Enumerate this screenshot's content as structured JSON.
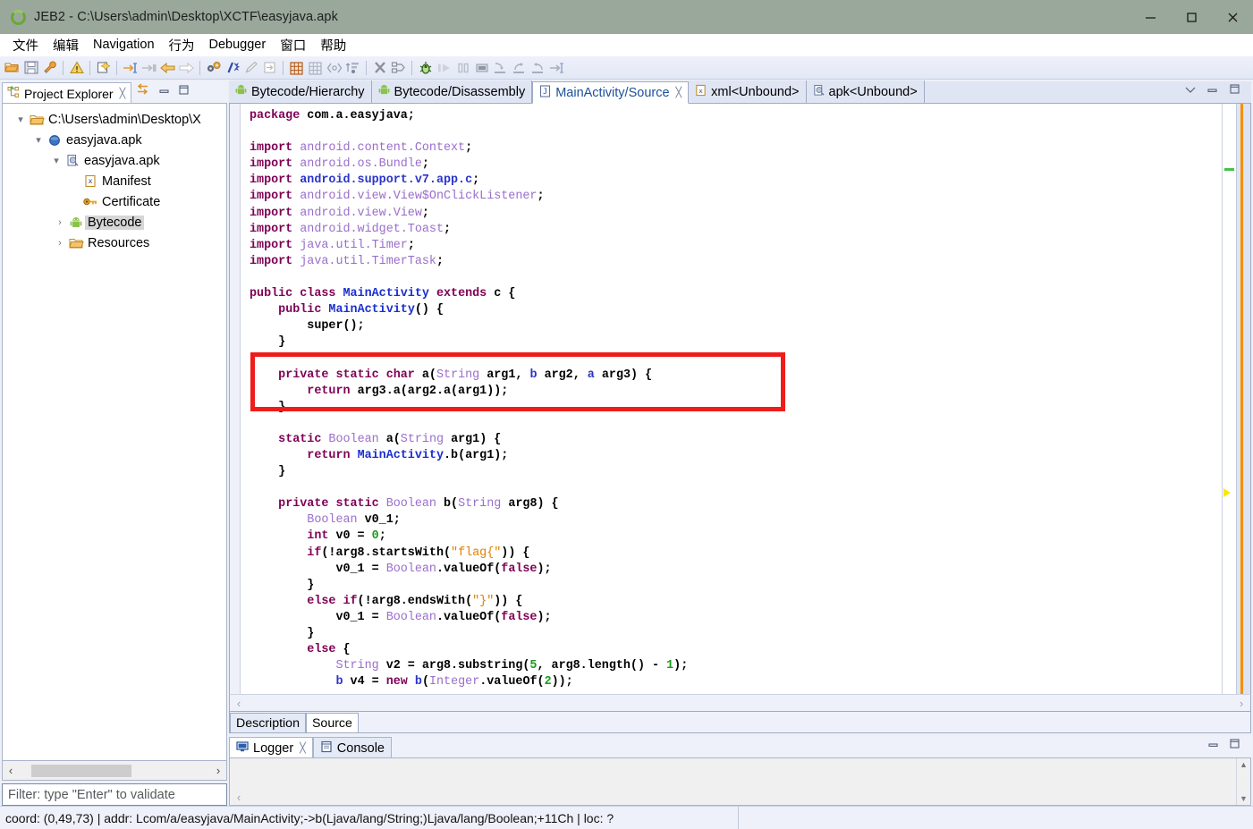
{
  "window": {
    "title": "JEB2 - C:\\Users\\admin\\Desktop\\XCTF\\easyjava.apk",
    "minimize": "—",
    "maximize": "□",
    "close": "✕"
  },
  "menubar": {
    "items": [
      {
        "label": "文件"
      },
      {
        "label": "编辑"
      },
      {
        "label": "Navigation"
      },
      {
        "label": "行为"
      },
      {
        "label": "Debugger"
      },
      {
        "label": "窗口"
      },
      {
        "label": "帮助"
      }
    ]
  },
  "toolbar": {
    "icons": [
      "open-folder-icon",
      "save-icon",
      "wrench-icon",
      "sep",
      "warning-icon",
      "sep",
      "new-document-icon",
      "sep",
      "goto-address-icon",
      "goto-reference-icon",
      "navigate-back-icon",
      "navigate-forward-icon",
      "sep",
      "gears-icon",
      "comment-icon",
      "edit-pencil-icon",
      "export-icon",
      "sep",
      "grid-table-icon",
      "grid-outline-icon",
      "code-brackets-icon",
      "sort-icon",
      "sep",
      "delete-x-icon",
      "refactor-icon",
      "sep",
      "debug-bug-icon",
      "step-over-icon",
      "pause-icon",
      "stop-icon",
      "step-into-icon",
      "step-return-icon",
      "step-out-icon",
      "run-to-line-icon"
    ]
  },
  "project_explorer": {
    "tab_label": "Project Explorer",
    "tab_icon": "project-explorer-icon",
    "close_icon": "close-icon",
    "tools": [
      "link-with-editor-icon",
      "minimize-icon",
      "maximize-icon"
    ],
    "tree": [
      {
        "label": "C:\\Users\\admin\\Desktop\\X",
        "icon": "folder-open-icon",
        "twisty": "▾",
        "indent": 0,
        "selected": false
      },
      {
        "label": "easyjava.apk",
        "icon": "blue-circle-icon",
        "twisty": "▾",
        "indent": 1,
        "selected": false
      },
      {
        "label": "easyjava.apk",
        "icon": "apk-icon",
        "twisty": "▾",
        "indent": 2,
        "selected": false
      },
      {
        "label": "Manifest",
        "icon": "xml-icon",
        "twisty": "",
        "indent": 3,
        "selected": false
      },
      {
        "label": "Certificate",
        "icon": "key-icon",
        "twisty": "",
        "indent": 3,
        "selected": false
      },
      {
        "label": "Bytecode",
        "icon": "android-icon",
        "twisty": "›",
        "indent": 3,
        "selected": true
      },
      {
        "label": "Resources",
        "icon": "folder-icon",
        "twisty": "›",
        "indent": 3,
        "selected": false
      }
    ],
    "hscroll": {
      "left_arrow": "‹",
      "right_arrow": "›"
    },
    "filter_placeholder": "Filter: type \"Enter\" to validate",
    "filter_value": ""
  },
  "editor": {
    "tabs": [
      {
        "label": "Bytecode/Hierarchy",
        "icon": "android-icon",
        "active": false,
        "closable": false
      },
      {
        "label": "Bytecode/Disassembly",
        "icon": "android-icon",
        "active": false,
        "closable": false
      },
      {
        "label": "MainActivity/Source",
        "icon": "java-file-icon",
        "active": true,
        "closable": true
      },
      {
        "label": "xml<Unbound>",
        "icon": "xml-icon",
        "active": false,
        "closable": false
      },
      {
        "label": "apk<Unbound>",
        "icon": "apk-icon",
        "active": false,
        "closable": false
      }
    ],
    "tools": [
      "chevron-down-icon",
      "minimize-icon",
      "maximize-icon"
    ],
    "close_icon": "✕",
    "sub_tabs": [
      {
        "label": "Description",
        "active": false
      },
      {
        "label": "Source",
        "active": true
      }
    ],
    "hscroll": {
      "left_arrow": "‹",
      "right_arrow": "›"
    },
    "markers": {
      "green_marker": "#46c247",
      "yellow_marker": "#ffe600",
      "scroll_line": "#f39200"
    },
    "highlight": {
      "color": "#ef1c1c",
      "label": "red-annotation-box"
    },
    "code_lines": [
      {
        "t": "kw",
        "v": "package"
      },
      {
        "t": "plain",
        "v": " com.a.easyjava;"
      },
      {
        "t": "nl"
      },
      {
        "t": "nl"
      },
      {
        "t": "kw",
        "v": "import"
      },
      {
        "t": "pkg",
        "v": " android.content.Context"
      },
      {
        "t": "plain",
        "v": ";"
      },
      {
        "t": "nl"
      },
      {
        "t": "kw",
        "v": "import"
      },
      {
        "t": "pkg",
        "v": " android.os.Bundle"
      },
      {
        "t": "plain",
        "v": ";"
      },
      {
        "t": "nl"
      },
      {
        "t": "kw",
        "v": "import"
      },
      {
        "t": "pkgb",
        "v": " android.support.v7.app.c"
      },
      {
        "t": "plain",
        "v": ";"
      },
      {
        "t": "nl"
      },
      {
        "t": "kw",
        "v": "import"
      },
      {
        "t": "pkg",
        "v": " android.view.View$OnClickListener"
      },
      {
        "t": "plain",
        "v": ";"
      },
      {
        "t": "nl"
      },
      {
        "t": "kw",
        "v": "import"
      },
      {
        "t": "pkg",
        "v": " android.view.View"
      },
      {
        "t": "plain",
        "v": ";"
      },
      {
        "t": "nl"
      },
      {
        "t": "kw",
        "v": "import"
      },
      {
        "t": "pkg",
        "v": " android.widget.Toast"
      },
      {
        "t": "plain",
        "v": ";"
      },
      {
        "t": "nl"
      },
      {
        "t": "kw",
        "v": "import"
      },
      {
        "t": "pkg",
        "v": " java.util.Timer"
      },
      {
        "t": "plain",
        "v": ";"
      },
      {
        "t": "nl"
      },
      {
        "t": "kw",
        "v": "import"
      },
      {
        "t": "pkg",
        "v": " java.util.TimerTask"
      },
      {
        "t": "plain",
        "v": ";"
      },
      {
        "t": "nl"
      }
    ],
    "code_text": "package com.a.easyjava;\n\nimport android.content.Context;\nimport android.os.Bundle;\nimport android.support.v7.app.c;\nimport android.view.View$OnClickListener;\nimport android.view.View;\nimport android.widget.Toast;\nimport java.util.Timer;\nimport java.util.TimerTask;\n\npublic class MainActivity extends c {\n    public MainActivity() {\n        super();\n    }\n\n    private static char a(String arg1, b arg2, a arg3) {\n        return arg3.a(arg2.a(arg1));\n    }\n\n    static Boolean a(String arg1) {\n        return MainActivity.b(arg1);\n    }\n\n    private static Boolean b(String arg8) {\n        Boolean v0_1;\n        int v0 = 0;\n        if(!arg8.startsWith(\"flag{\")) {\n            v0_1 = Boolean.valueOf(false);\n        }\n        else if(!arg8.endsWith(\"}\")) {\n            v0_1 = Boolean.valueOf(false);\n        }\n        else {\n            String v2 = arg8.substring(5, arg8.length() - 1);\n            b v4 = new b(Integer.valueOf(2));"
  },
  "bottom_panel": {
    "tabs": [
      {
        "label": "Logger",
        "icon": "logger-icon",
        "active": true,
        "closable": true
      },
      {
        "label": "Console",
        "icon": "console-icon",
        "active": false,
        "closable": false
      }
    ],
    "close_icon": "✕",
    "tools": [
      "minimize-icon",
      "maximize-icon"
    ],
    "hscroll": {
      "left_arrow": "‹",
      "right_arrow": "›"
    },
    "vscroll": {
      "up_arrow": "▲",
      "down_arrow": "▼"
    },
    "content": ""
  },
  "statusbar": {
    "coord": "coord: (0,49,73) | addr: Lcom/a/easyjava/MainActivity;->b(Ljava/lang/String;)Ljava/lang/Boolean;+11Ch | loc: ?",
    "right_cell": ""
  }
}
